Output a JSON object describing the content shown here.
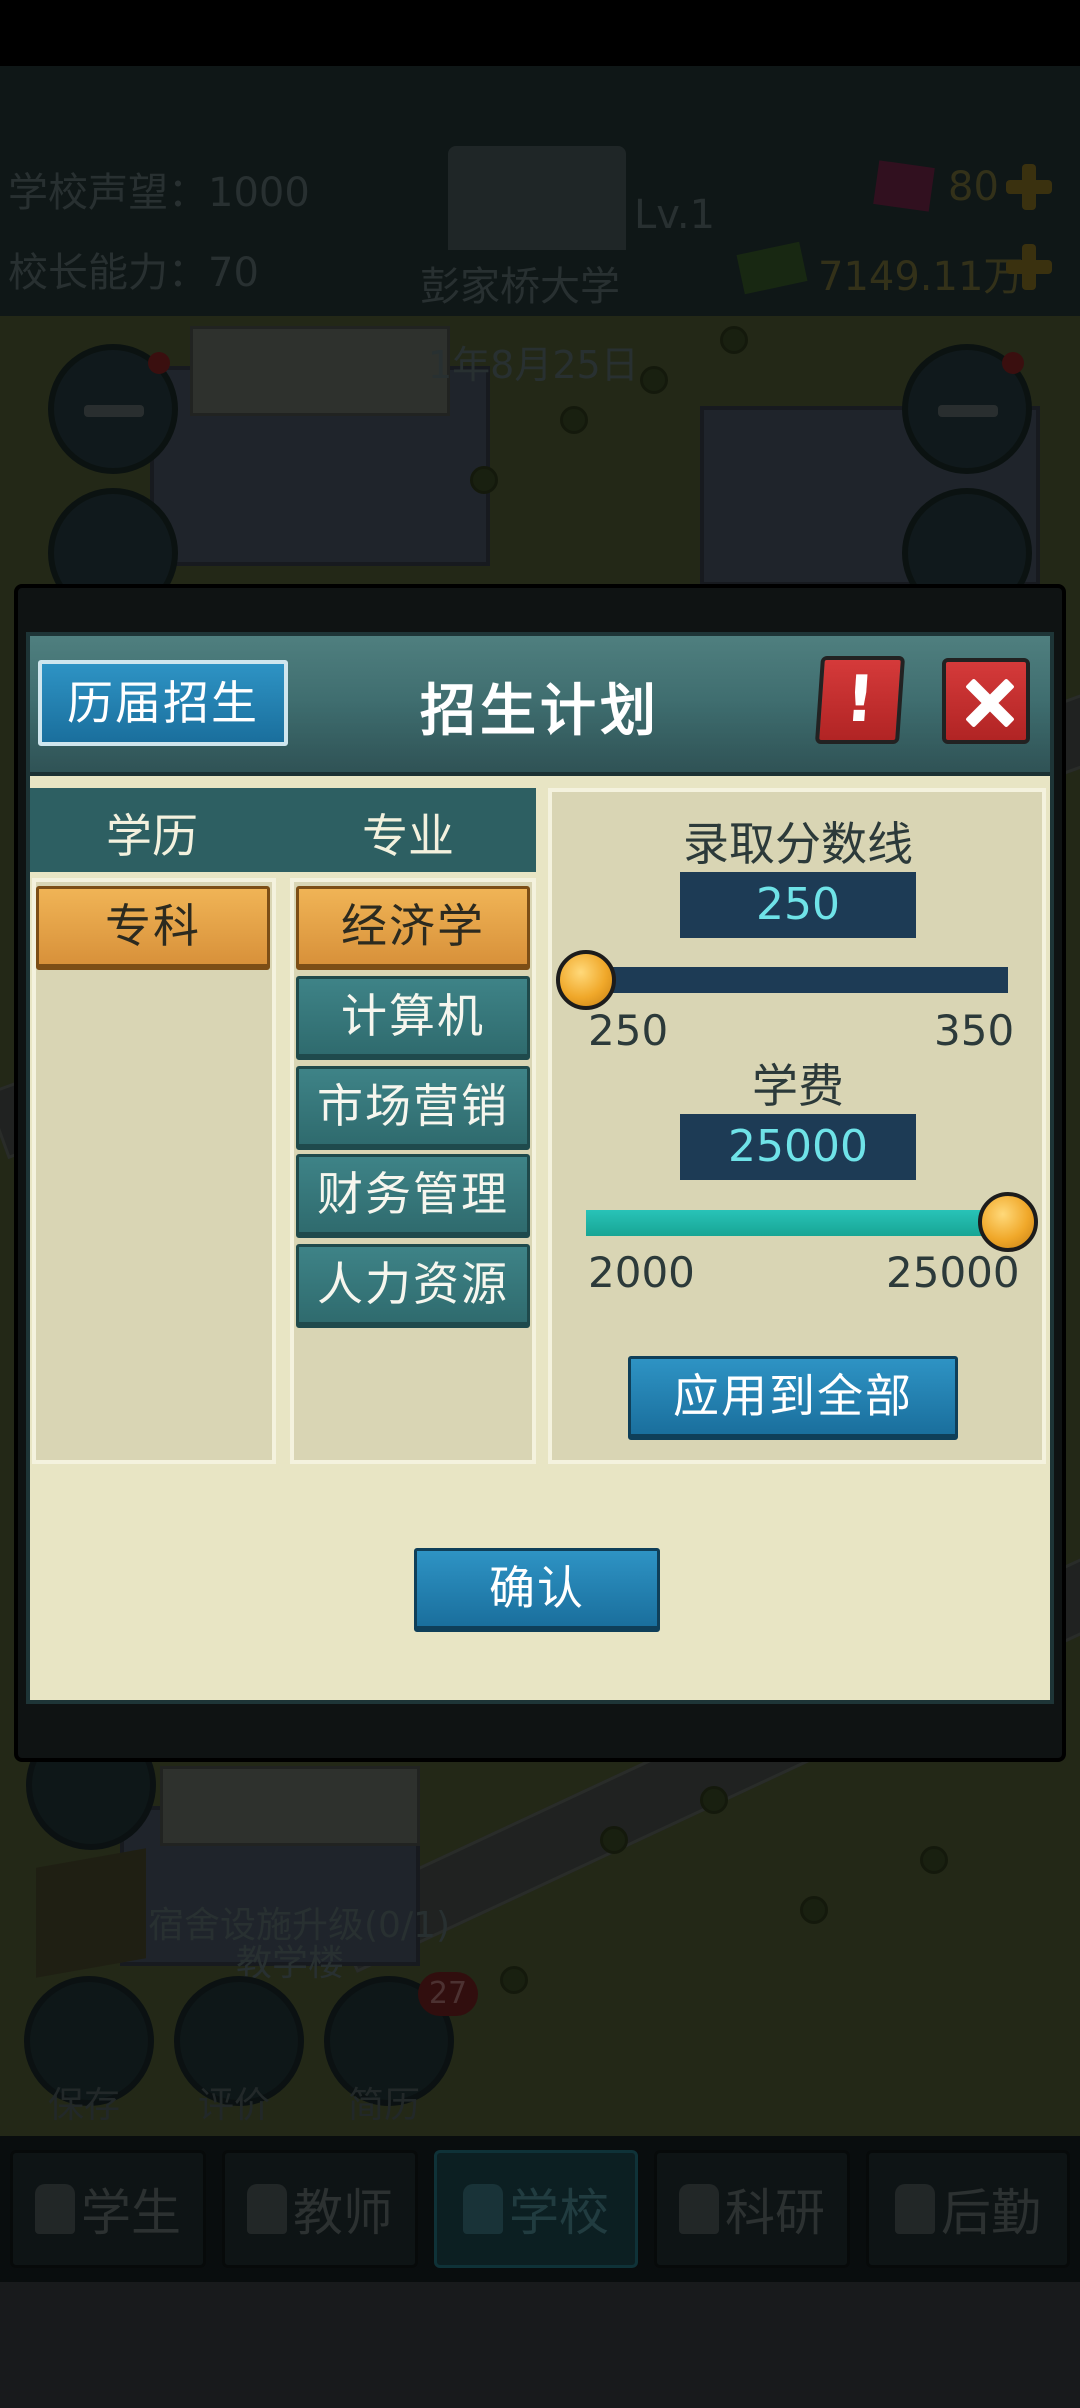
{
  "hud": {
    "reputation": "学校声望：1000",
    "ability": "校长能力：70",
    "school_name": "彭家桥大学",
    "level": "Lv.1",
    "date": "1年8月25日",
    "gems": "80",
    "money": "7149.11万"
  },
  "dialog": {
    "title": "招生计划",
    "history_button": "历届招生",
    "alert_button": "!",
    "confirm_button": "确认",
    "apply_all_button": "应用到全部"
  },
  "columns": {
    "education_header": "学历",
    "major_header": "专业",
    "education": [
      {
        "label": "专科",
        "selected": true
      }
    ],
    "majors": [
      {
        "label": "经济学",
        "selected": true
      },
      {
        "label": "计算机",
        "selected": false
      },
      {
        "label": "市场营销",
        "selected": false
      },
      {
        "label": "财务管理",
        "selected": false
      },
      {
        "label": "人力资源",
        "selected": false
      }
    ]
  },
  "settings": {
    "cutoff": {
      "label": "录取分数线",
      "value": "250",
      "min": "250",
      "max": "350",
      "fraction": 0.0
    },
    "tuition": {
      "label": "学费",
      "value": "25000",
      "min": "2000",
      "max": "25000",
      "fraction": 1.0
    }
  },
  "notice": {
    "quest": "宿舍设施升级(0/1)",
    "building": "教学楼"
  },
  "actions": {
    "save": "保存",
    "review": "评价",
    "resume": "简历",
    "resume_badge": "27"
  },
  "tabs": [
    {
      "label": "学生",
      "icon": "student-icon",
      "active": false
    },
    {
      "label": "教师",
      "icon": "teacher-icon",
      "active": false
    },
    {
      "label": "学校",
      "icon": "school-icon",
      "active": true
    },
    {
      "label": "科研",
      "icon": "research-icon",
      "active": false
    },
    {
      "label": "后勤",
      "icon": "logistics-icon",
      "active": false
    }
  ],
  "colors": {
    "header_teal": "#3d6b6d",
    "orange_selected": "#e8a44a",
    "blue_button": "#2383b5",
    "value_box": "#1d3b55",
    "value_text": "#6fe3e8",
    "slider_fill": "#1fb8a8"
  }
}
